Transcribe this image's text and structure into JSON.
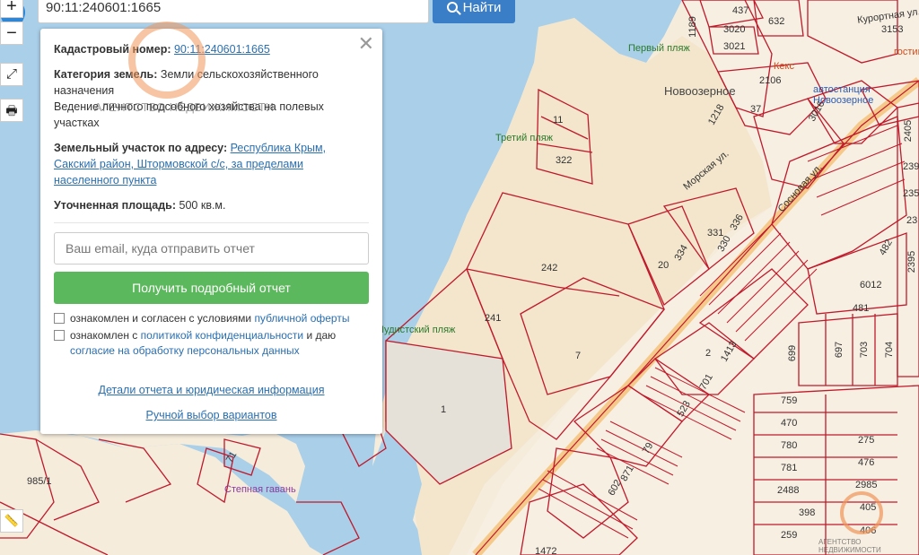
{
  "search": {
    "value": "90:11:240601:1665",
    "button_label": "Найти"
  },
  "toolbar": {
    "zoom_in": "+",
    "zoom_out": "−",
    "fullscreen": "⤢",
    "print": "🖶",
    "ruler": "📏"
  },
  "popup": {
    "cadastral_label": "Кадастровый номер:",
    "cadastral_value": "90:11:240601:1665",
    "category_label": "Категория земель:",
    "category_value": "Земли сельскохозяйственного назначения",
    "use_value": "Ведение личного подсобного хозяйства на полевых участках",
    "address_label": "Земельный участок по адресу:",
    "address_value": "Республика Крым, Сакский район, Штормовской с/с, за пределами населенного пункта",
    "area_label": "Уточненная площадь:",
    "area_value": "500 кв.м.",
    "email_placeholder": "Ваш email, куда отправить отчет",
    "cta_label": "Получить подробный отчет",
    "check1_text": "ознакомлен и согласен с условиями ",
    "check1_link": "публичной оферты",
    "check2_text": "ознакомлен с ",
    "check2_link": "политикой конфиденциальности",
    "check2_text2": " и даю ",
    "check2_link2": "согласие на обработку персональных данных",
    "details_link": "Детали отчета и юридическая информация",
    "manual_link": "Ручной выбор вариантов",
    "close": "✕"
  },
  "watermark": {
    "text": "АГЕНТСТВО НЕДВИЖИМОСТИ",
    "corner_text": "АГЕНТСТВО НЕДВИЖИМОСТИ"
  },
  "map": {
    "places": [
      "Новоозерное"
    ],
    "pois": [
      "Первый пляж",
      "Третий пляж",
      "Нудистский пляж",
      "Степная гавань",
      "Кекс",
      "автостанция Новоозерное",
      "гостиница"
    ],
    "streets": [
      "Курортная ул.",
      "Морская ул.",
      "Сосновая ул.",
      "Морская ул."
    ],
    "parcels": [
      "437",
      "632",
      "3153",
      "3020",
      "3021",
      "1189",
      "2106",
      "1218",
      "37",
      "3016",
      "11",
      "322",
      "242",
      "241",
      "7",
      "1",
      "20",
      "334",
      "331",
      "330",
      "336",
      "482",
      "6012",
      "481",
      "2",
      "1413",
      "699",
      "697",
      "703",
      "704",
      "701",
      "523",
      "759",
      "470",
      "275",
      "780",
      "476",
      "781",
      "2488",
      "2985",
      "398",
      "406",
      "405",
      "259",
      "79",
      "871",
      "602",
      "1472",
      "71",
      "985/1",
      "2405",
      "239",
      "235",
      "2395",
      "23"
    ]
  },
  "colors": {
    "parcel": "#c0192b",
    "water": "#a9cfe9",
    "land": "#f5ecdc",
    "accent": "#3b7ec8",
    "cta": "#5cb85c"
  }
}
